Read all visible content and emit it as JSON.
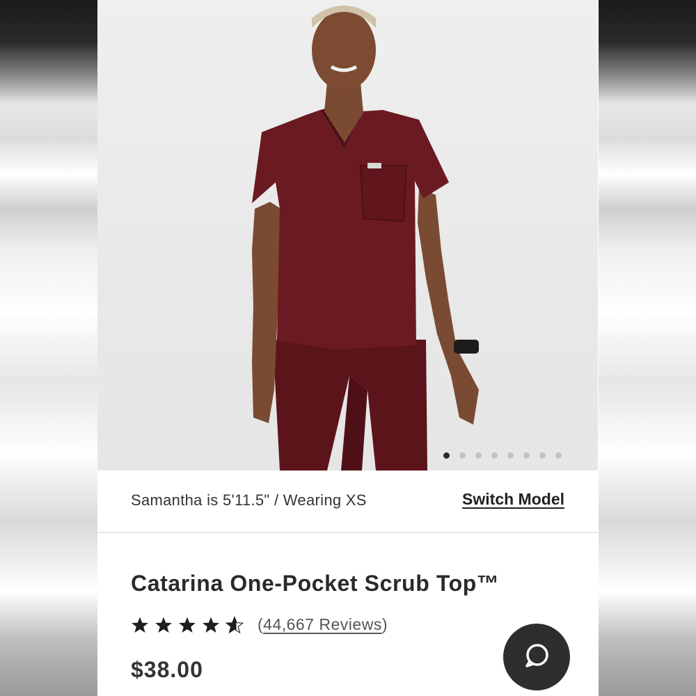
{
  "product_image": {
    "carousel": {
      "total": 8,
      "active_index": 0
    }
  },
  "model_info": {
    "text": "Samantha is 5'11.5\" / Wearing XS",
    "switch_label": "Switch Model"
  },
  "product": {
    "title": "Catarina One-Pocket Scrub Top™",
    "rating": 4.5,
    "rating_max": 5,
    "reviews_open": "(",
    "reviews_label": "44,667 Reviews",
    "reviews_close": ")",
    "price": "$38.00"
  },
  "colors": {
    "garment": "#6b1a22",
    "text_dark": "#2a2a2a",
    "chat_button": "#2e2e2e"
  },
  "icons": {
    "chat": "chat-bubble-icon",
    "star": "star-icon"
  }
}
